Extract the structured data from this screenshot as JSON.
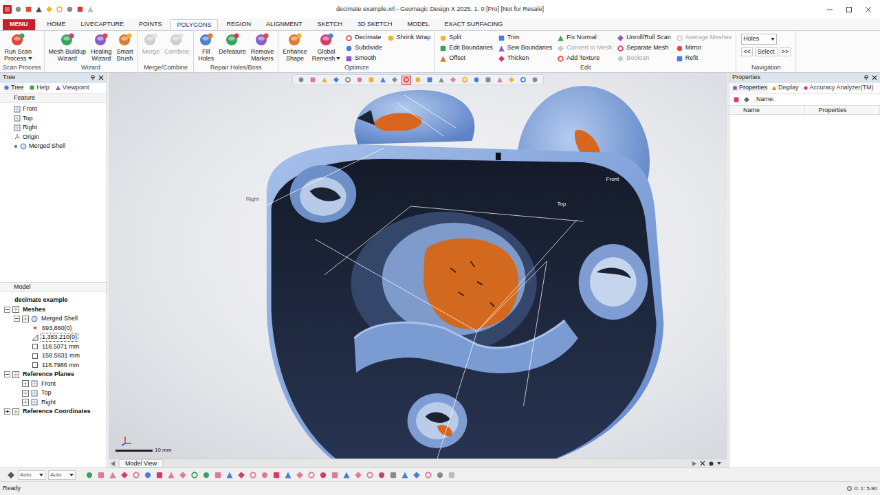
{
  "window": {
    "title": "decimate example.xrl - Geomagic Design X 2025. 1. 0 [Pro] [Not for Resale]"
  },
  "menu_button": "MENU",
  "ribbon_tabs": [
    {
      "label": "HOME",
      "selected": false
    },
    {
      "label": "LIVECAPTURE",
      "selected": false
    },
    {
      "label": "POINTS",
      "selected": false
    },
    {
      "label": "POLYGONS",
      "selected": true
    },
    {
      "label": "REGION",
      "selected": false
    },
    {
      "label": "ALIGNMENT",
      "selected": false
    },
    {
      "label": "SKETCH",
      "selected": false
    },
    {
      "label": "3D SKETCH",
      "selected": false
    },
    {
      "label": "MODEL",
      "selected": false
    },
    {
      "label": "EXACT SURFACING",
      "selected": false
    }
  ],
  "ribbon_groups": [
    {
      "title": "Scan Process",
      "items": [
        {
          "kind": "large",
          "lines": [
            "Run Scan",
            "Process"
          ],
          "dropdown": true,
          "disabled": false
        }
      ]
    },
    {
      "title": "Wizard",
      "items": [
        {
          "kind": "large",
          "lines": [
            "Mesh Buildup",
            "Wizard"
          ],
          "dropdown": false,
          "disabled": false
        },
        {
          "kind": "large",
          "lines": [
            "Healing",
            "Wizard"
          ],
          "dropdown": false,
          "disabled": false
        },
        {
          "kind": "large",
          "lines": [
            "Smart",
            "Brush"
          ],
          "dropdown": false,
          "disabled": false
        }
      ]
    },
    {
      "title": "Merge/Combine",
      "items": [
        {
          "kind": "large",
          "lines": [
            "Merge"
          ],
          "dropdown": false,
          "disabled": true
        },
        {
          "kind": "large",
          "lines": [
            "Combine"
          ],
          "dropdown": false,
          "disabled": true
        }
      ]
    },
    {
      "title": "Repair Holes/Boss",
      "items": [
        {
          "kind": "large",
          "lines": [
            "Fill",
            "Holes"
          ],
          "dropdown": false,
          "disabled": false
        },
        {
          "kind": "large",
          "lines": [
            "Defeature"
          ],
          "dropdown": false,
          "disabled": false
        },
        {
          "kind": "large",
          "lines": [
            "Remove",
            "Markers"
          ],
          "dropdown": false,
          "disabled": false
        }
      ]
    },
    {
      "title": "Optimize",
      "items": [
        {
          "kind": "large",
          "lines": [
            "Enhance",
            "Shape"
          ],
          "dropdown": false,
          "disabled": false
        },
        {
          "kind": "large",
          "lines": [
            "Global",
            "Remesh"
          ],
          "dropdown": true,
          "disabled": false
        },
        {
          "kind": "column",
          "buttons": [
            {
              "label": "Decimate",
              "disabled": false
            },
            {
              "label": "Subdivide",
              "disabled": false
            },
            {
              "label": "Smooth",
              "disabled": false
            }
          ]
        },
        {
          "kind": "column",
          "buttons": [
            {
              "label": "Shrink Wrap",
              "disabled": false
            }
          ]
        }
      ]
    },
    {
      "title": "Edit",
      "items": [
        {
          "kind": "column",
          "buttons": [
            {
              "label": "Split",
              "disabled": false
            },
            {
              "label": "Edit Boundaries",
              "disabled": false
            },
            {
              "label": "Offset",
              "disabled": false
            }
          ]
        },
        {
          "kind": "column",
          "buttons": [
            {
              "label": "Trim",
              "disabled": false
            },
            {
              "label": "Sew Boundaries",
              "disabled": false
            },
            {
              "label": "Thicken",
              "disabled": false
            }
          ]
        },
        {
          "kind": "column",
          "buttons": [
            {
              "label": "Fix Normal",
              "disabled": false
            },
            {
              "label": "Convert to Mesh",
              "disabled": true
            },
            {
              "label": "Add Texture",
              "disabled": false
            }
          ]
        },
        {
          "kind": "column",
          "buttons": [
            {
              "label": "Unroll/Roll Scan",
              "disabled": false
            },
            {
              "label": "Separate Mesh",
              "disabled": false
            },
            {
              "label": "Boolean",
              "disabled": true
            }
          ]
        },
        {
          "kind": "column",
          "buttons": [
            {
              "label": "Average Meshes",
              "disabled": true
            },
            {
              "label": "Mirror",
              "disabled": false
            },
            {
              "label": "Refit",
              "disabled": false
            }
          ]
        }
      ]
    },
    {
      "title": "Navigation",
      "items": [
        {
          "kind": "navigation",
          "field": "Holes",
          "prev": "<<",
          "action": "Select",
          "next": ">>"
        }
      ]
    }
  ],
  "tree_panel": {
    "title": "Tree",
    "tabs": [
      {
        "label": "Tree",
        "selected": true
      },
      {
        "label": "Help",
        "selected": false
      },
      {
        "label": "Viewpoint",
        "selected": false
      }
    ],
    "section": "Feature",
    "items": [
      {
        "label": "Front",
        "kind": "plane"
      },
      {
        "label": "Top",
        "kind": "plane"
      },
      {
        "label": "Right",
        "kind": "plane"
      },
      {
        "label": "Origin",
        "kind": "origin"
      },
      {
        "label": "Merged Shell",
        "kind": "mesh"
      }
    ]
  },
  "model_panel": {
    "title": "Model",
    "items": [
      {
        "label": "decimate example",
        "kind": "root",
        "depth": 0,
        "selected": false
      },
      {
        "label": "Meshes",
        "kind": "group",
        "depth": 0,
        "expanded": true,
        "selected": false
      },
      {
        "label": "Merged Shell",
        "kind": "mesh",
        "depth": 1,
        "expanded": true,
        "selected": false
      },
      {
        "label": "693,860(0)",
        "kind": "vertices",
        "depth": 2,
        "selected": false
      },
      {
        "label": "1,383,210(0)",
        "kind": "faces",
        "depth": 2,
        "selected": true
      },
      {
        "label": "118.5071 mm",
        "kind": "size",
        "depth": 2,
        "selected": false
      },
      {
        "label": "158.5831 mm",
        "kind": "size",
        "depth": 2,
        "selected": false
      },
      {
        "label": "118.7986 mm",
        "kind": "size",
        "depth": 2,
        "selected": false
      },
      {
        "label": "Reference Planes",
        "kind": "group",
        "depth": 0,
        "expanded": true,
        "selected": false
      },
      {
        "label": "Front",
        "kind": "plane",
        "depth": 1,
        "selected": false
      },
      {
        "label": "Top",
        "kind": "plane",
        "depth": 1,
        "selected": false
      },
      {
        "label": "Right",
        "kind": "plane",
        "depth": 1,
        "selected": false
      },
      {
        "label": "Reference Coordinates",
        "kind": "group",
        "depth": 0,
        "expanded": false,
        "selected": false
      }
    ]
  },
  "viewport": {
    "view_tools": [
      {
        "selected": false
      },
      {
        "selected": false
      },
      {
        "selected": false
      },
      {
        "selected": false
      },
      {
        "selected": false
      },
      {
        "selected": false
      },
      {
        "selected": false
      },
      {
        "selected": false
      },
      {
        "selected": false
      },
      {
        "selected": true
      },
      {
        "selected": false
      },
      {
        "selected": false
      },
      {
        "selected": false
      },
      {
        "selected": false
      },
      {
        "selected": false
      },
      {
        "selected": false
      },
      {
        "selected": false
      },
      {
        "selected": false
      },
      {
        "selected": false
      },
      {
        "selected": false
      },
      {
        "selected": false
      }
    ],
    "labels": [
      {
        "text": "Right"
      },
      {
        "text": "Front"
      },
      {
        "text": "Top"
      }
    ],
    "scale": "10 mm",
    "tab": "Model View"
  },
  "properties_panel": {
    "title": "Properties",
    "tabs": [
      {
        "label": "Properties",
        "selected": true
      },
      {
        "label": "Display",
        "selected": false
      },
      {
        "label": "Accuracy Analyzer(TM)",
        "selected": false
      }
    ],
    "name_label": "Name:",
    "columns": [
      "Name",
      "Properties"
    ]
  },
  "bottom_toolbar": {
    "fields": [
      "Auto",
      "Auto"
    ]
  },
  "status_bar": {
    "left": "Ready",
    "right": "0: 1: 5.90"
  }
}
